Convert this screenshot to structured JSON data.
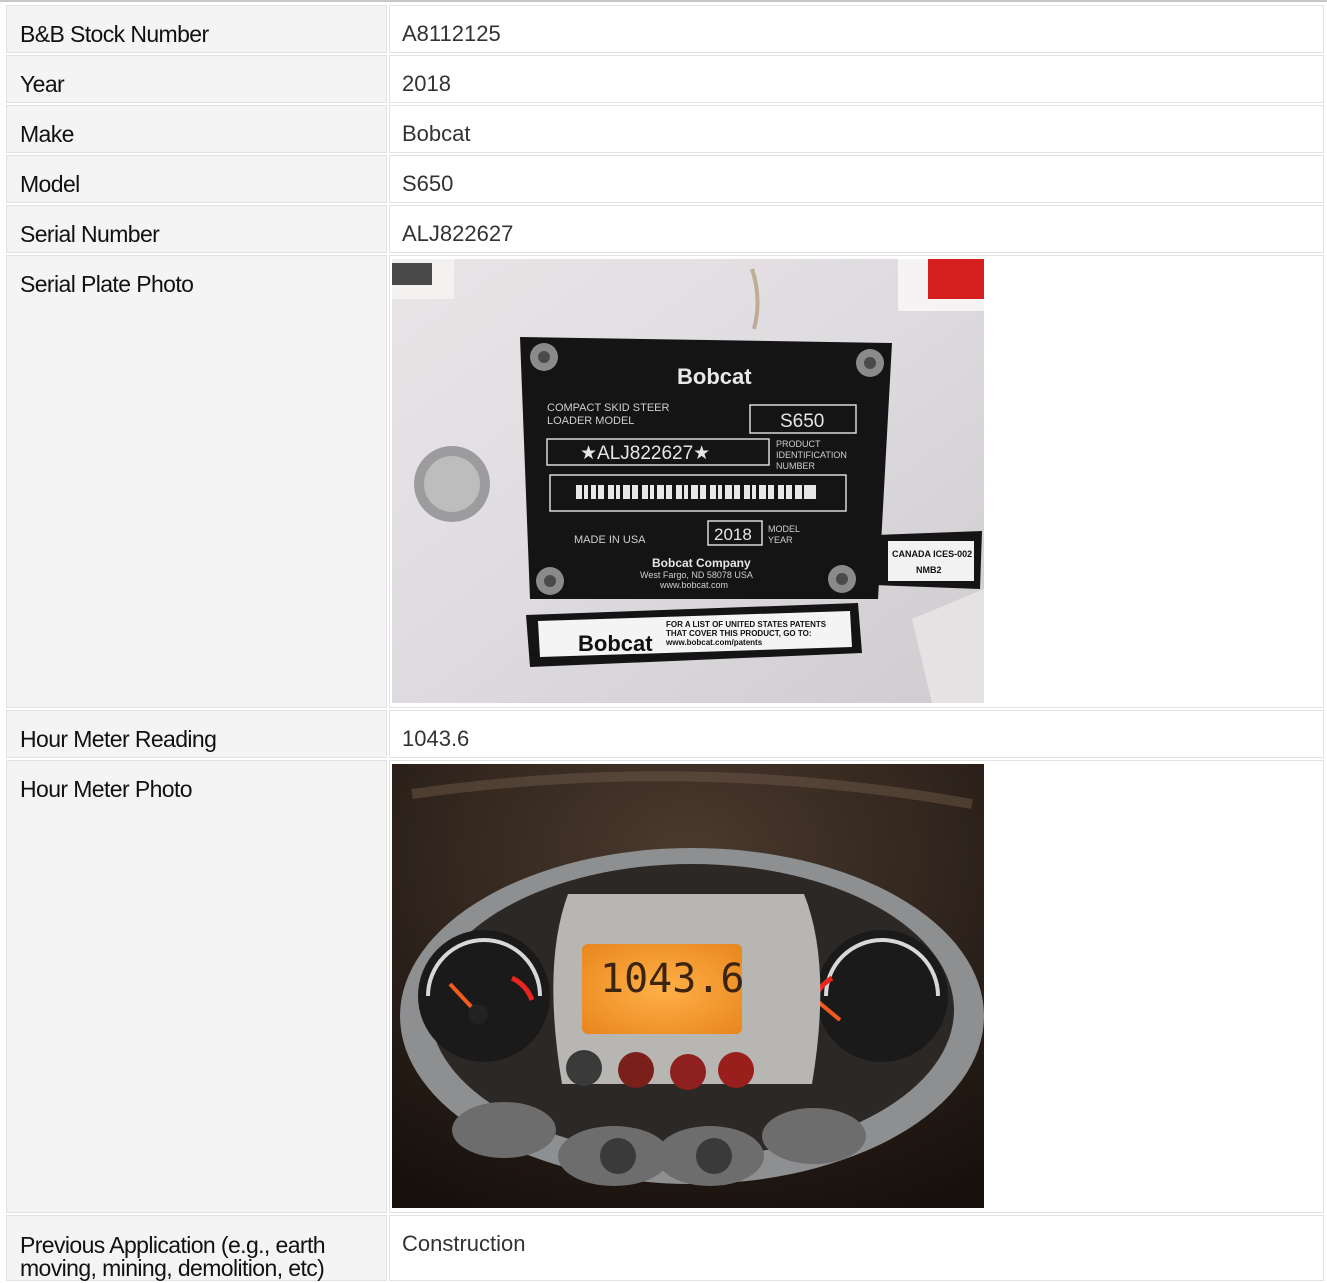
{
  "rows": {
    "stock": {
      "label": "B&B Stock Number",
      "value": "A8112125"
    },
    "year": {
      "label": "Year",
      "value": "2018"
    },
    "make": {
      "label": "Make",
      "value": "Bobcat"
    },
    "model": {
      "label": "Model",
      "value": "S650"
    },
    "serial": {
      "label": "Serial Number",
      "value": "ALJ822627"
    },
    "serial_photo": {
      "label": "Serial Plate Photo",
      "plate": {
        "brand": "Bobcat",
        "type_line1": "COMPACT SKID STEER",
        "type_line2": "LOADER MODEL",
        "model": "S650",
        "pin": "★ALJ822627★",
        "pin_caption1": "PRODUCT",
        "pin_caption2": "IDENTIFICATION",
        "pin_caption3": "NUMBER",
        "made_in": "MADE IN USA",
        "model_year": "2018",
        "model_year_caption1": "MODEL",
        "model_year_caption2": "YEAR",
        "company": "Bobcat Company",
        "address": "West Fargo, ND 58078 USA",
        "website": "www.bobcat.com",
        "patent_brand": "Bobcat",
        "patent_line1": "FOR A LIST OF UNITED STATES PATENTS",
        "patent_line2": "THAT COVER THIS PRODUCT, GO TO:",
        "patent_line3": "www.bobcat.com/patents",
        "canada_line1": "CANADA ICES-002",
        "canada_line2": "NMB2"
      }
    },
    "hours": {
      "label": "Hour Meter Reading",
      "value": "1043.6"
    },
    "hour_photo": {
      "label": "Hour Meter Photo",
      "display": "1043.6"
    },
    "application": {
      "label": "Previous Application (e.g., earth moving, mining, demolition, etc)",
      "value": "Construction"
    }
  },
  "colors": {
    "label_bg": "#f4f4f4",
    "border": "#e2e2e2",
    "plate": "#141414",
    "lcd": "#f39a2e"
  }
}
